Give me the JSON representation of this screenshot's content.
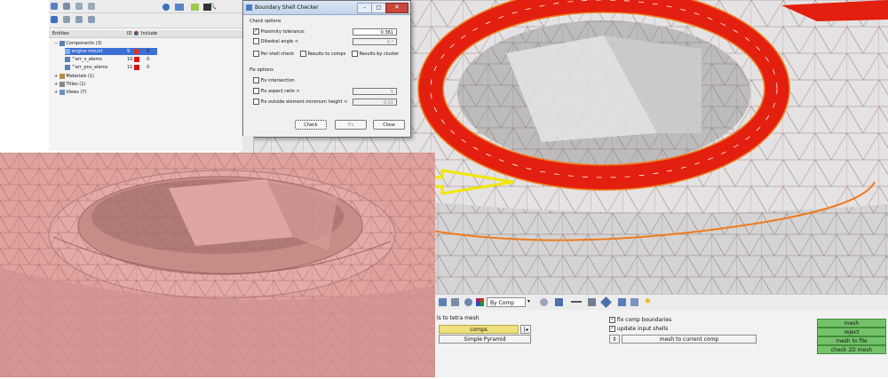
{
  "browser": {
    "columns": {
      "entities": "Entities",
      "id": "ID",
      "include": "Include"
    },
    "rows": [
      {
        "label": "Components (3)",
        "id": "",
        "color": "",
        "include": ""
      },
      {
        "label": "engine mount",
        "id": "9",
        "color": "#c93a3a",
        "include": "0"
      },
      {
        "label": "^err_v_elems",
        "id": "10",
        "color": "#e01818",
        "include": "0"
      },
      {
        "label": "^err_pnv_elems",
        "id": "11",
        "color": "#d01010",
        "include": "0"
      },
      {
        "label": "Materials (1)",
        "id": "",
        "color": "",
        "include": ""
      },
      {
        "label": "Titles (1)",
        "id": "",
        "color": "",
        "include": ""
      },
      {
        "label": "Views (7)",
        "id": "",
        "color": "",
        "include": ""
      }
    ]
  },
  "dialog": {
    "title": "Boundary Shell Checker",
    "check_options_label": "Check options",
    "proximity_label": "Proximity tolerance:",
    "proximity_value": "0.381",
    "proximity_checked": true,
    "dihedral_label": "Dihedral angle <",
    "dihedral_value": "0.°",
    "dihedral_checked": false,
    "per_shell_label": "Per shell check",
    "results_comps_label": "Results to comps",
    "results_cluster_label": "Results by cluster",
    "fix_options_label": "Fix options",
    "fix_intersection_label": "Fix intersection",
    "fix_aspect_label": "Fix aspect ratio >",
    "fix_aspect_value": "5",
    "fix_outside_label": "Fix outside element minimum height <",
    "fix_outside_value": "0.01",
    "check_button": "Check",
    "fix_button": "Fix",
    "close_button": "Close"
  },
  "toolbar": {
    "by_comp_label": "By Comp"
  },
  "panel": {
    "tetra_label": "ls to tetra mesh",
    "comps_button": "comps",
    "pyramid_button": "Simple Pyramid",
    "fix_comp_boundaries_label": "fix comp boundaries",
    "fix_comp_boundaries_checked": true,
    "update_input_shells_label": "update input shells",
    "update_input_shells_checked": true,
    "mesh_to_current_label": "mesh to current comp",
    "mesh_button": "mesh",
    "reject_button": "reject",
    "mesh_to_file_button": "mesh to file",
    "check_2d_button": "check 2D mesh"
  },
  "colors": {
    "accent_green": "#74c26a",
    "error_red": "#e31f0f",
    "highlight_orange": "#f07a1a",
    "arrow_yellow": "#f2e600",
    "pink_mesh": "#e9aaa4"
  }
}
